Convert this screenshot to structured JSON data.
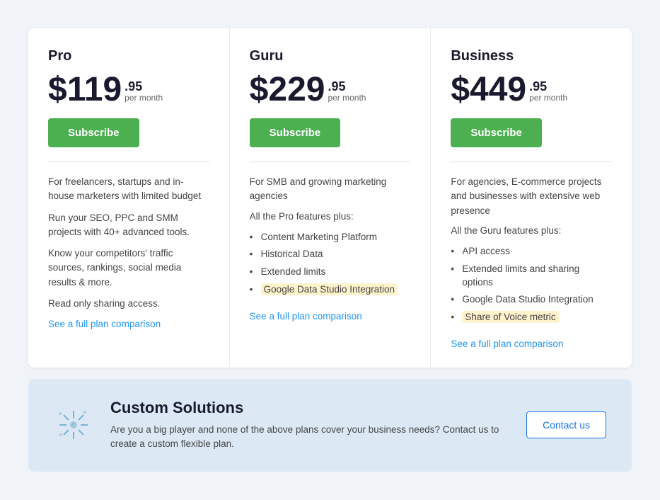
{
  "plans": [
    {
      "name": "Pro",
      "price_main": "$119",
      "price_cents": ".95",
      "price_period": "per month",
      "subscribe_label": "Subscribe",
      "description_lines": [
        "For freelancers, startups and in-house marketers with limited budget",
        "Run your SEO, PPC and SMM projects with 40+ advanced tools.",
        "Know your competitors' traffic sources, rankings, social media results & more.",
        "Read only sharing access."
      ],
      "features_label": null,
      "features": [],
      "see_plan_label": "See a full plan comparison"
    },
    {
      "name": "Guru",
      "price_main": "$229",
      "price_cents": ".95",
      "price_period": "per month",
      "subscribe_label": "Subscribe",
      "description_lines": [
        "For SMB and growing marketing agencies",
        "All the Pro features plus:"
      ],
      "features": [
        {
          "text": "Content Marketing Platform",
          "highlight": false
        },
        {
          "text": "Historical Data",
          "highlight": false
        },
        {
          "text": "Extended limits",
          "highlight": false
        },
        {
          "text": "Google Data Studio Integration",
          "highlight": true
        }
      ],
      "see_plan_label": "See a full plan comparison"
    },
    {
      "name": "Business",
      "price_main": "$449",
      "price_cents": ".95",
      "price_period": "per month",
      "subscribe_label": "Subscribe",
      "description_lines": [
        "For agencies, E-commerce projects and businesses with extensive web presence",
        "All the Guru features plus:"
      ],
      "features": [
        {
          "text": "API access",
          "highlight": false
        },
        {
          "text": "Extended limits and sharing options",
          "highlight": false
        },
        {
          "text": "Google Data Studio Integration",
          "highlight": false
        },
        {
          "text": "Share of Voice metric",
          "highlight": true
        }
      ],
      "see_plan_label": "See a full plan comparison"
    }
  ],
  "custom_solutions": {
    "title": "Custom Solutions",
    "description": "Are you a big player and none of the above plans cover your business needs? Contact us to create a custom flexible plan.",
    "contact_label": "Contact us"
  }
}
